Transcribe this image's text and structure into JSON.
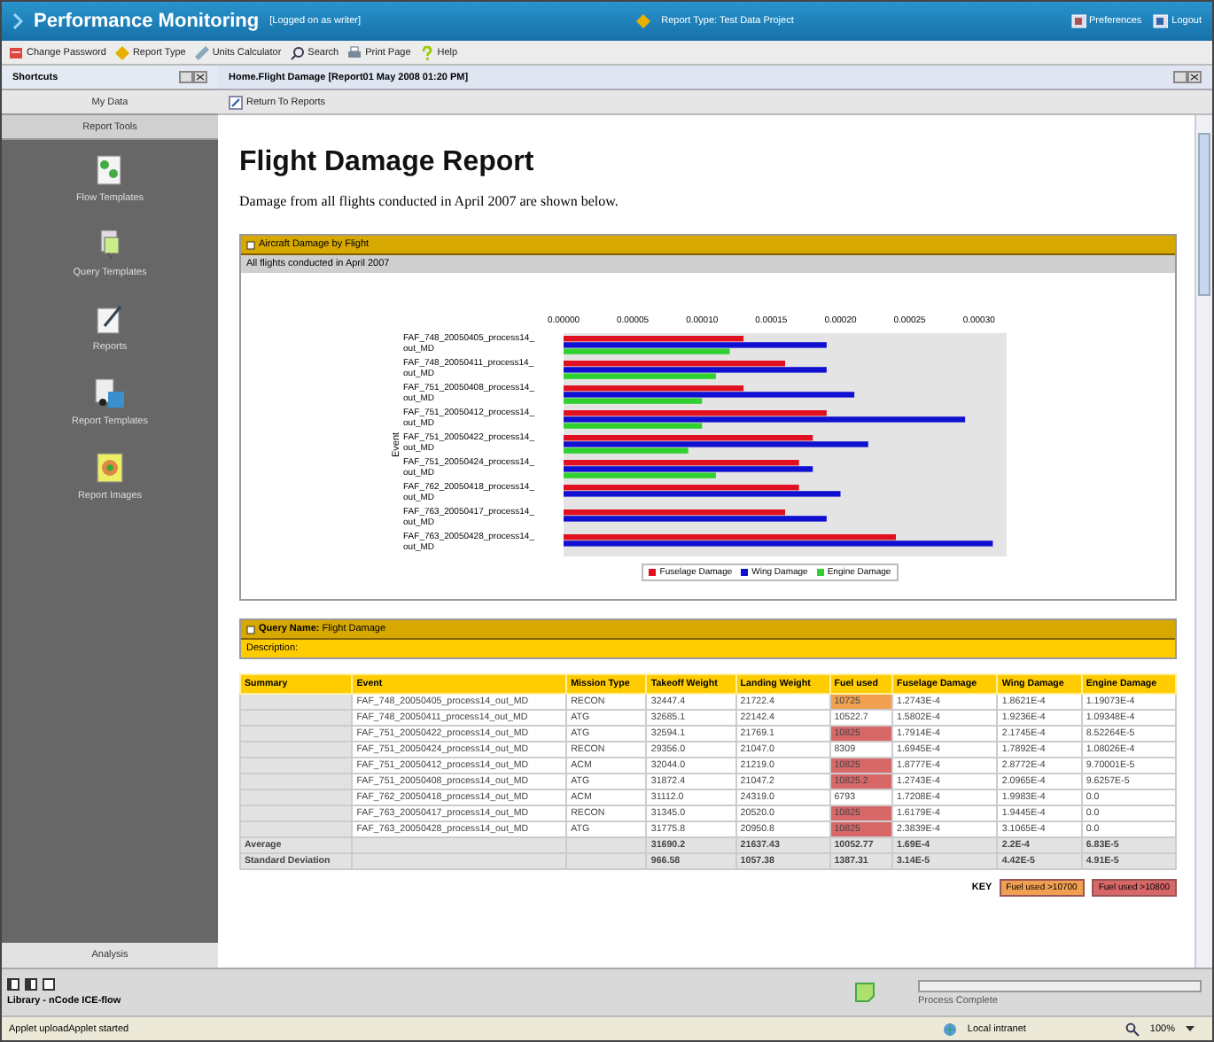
{
  "header": {
    "title": "Performance Monitoring",
    "login_note": "[Logged on as writer]",
    "report_type": "Report Type: Test Data Project",
    "actions": [
      "Preferences",
      "Logout"
    ]
  },
  "toolbar": [
    "Change Password",
    "Report Type",
    "Units Calculator",
    "Search",
    "Print Page",
    "Help"
  ],
  "sidebar": {
    "title": "Shortcuts",
    "sections": [
      {
        "label": "My Data",
        "selected": false
      },
      {
        "label": "Report Tools",
        "selected": true
      }
    ],
    "items": [
      "Flow Templates",
      "Query Templates",
      "Reports",
      "Report Templates",
      "Report Images"
    ],
    "footer": "Analysis"
  },
  "panel": {
    "title": "Home.Flight Damage [Report01 May 2008 01:20 PM]",
    "action": "Return To Reports"
  },
  "report": {
    "title": "Flight Damage Report",
    "intro": "Damage from all flights conducted in April 2007 are shown below.",
    "chart_panel": {
      "title": "Aircraft Damage by Flight",
      "subtitle": "All flights conducted in April 2007",
      "chart_data": {
        "type": "bar",
        "orientation": "horizontal",
        "ylabel": "Event",
        "categories": [
          "FAF_748_20050405_process14_out_MD",
          "FAF_748_20050411_process14_out_MD",
          "FAF_751_20050408_process14_out_MD",
          "FAF_751_20050412_process14_out_MD",
          "FAF_751_20050422_process14_out_MD",
          "FAF_751_20050424_process14_out_MD",
          "FAF_762_20050418_process14_out_MD",
          "FAF_763_20050417_process14_out_MD",
          "FAF_763_20050428_process14_out_MD"
        ],
        "series": [
          {
            "name": "Fuselage Damage",
            "color": "#e01020",
            "values": [
              0.00013,
              0.00016,
              0.00013,
              0.00019,
              0.00018,
              0.00017,
              0.00017,
              0.00016,
              0.00024
            ]
          },
          {
            "name": "Wing Damage",
            "color": "#1010d0",
            "values": [
              0.00019,
              0.00019,
              0.00021,
              0.00029,
              0.00022,
              0.00018,
              0.0002,
              0.00019,
              0.00031
            ]
          },
          {
            "name": "Engine Damage",
            "color": "#30d030",
            "values": [
              0.00012,
              0.00011,
              0.0001,
              0.0001,
              9e-05,
              0.00011,
              0,
              0,
              0
            ]
          }
        ],
        "legend": true,
        "xlim": [
          0,
          0.00032
        ],
        "xticks": [
          {
            "value": 0,
            "label": "0.00000"
          },
          {
            "value": 5e-05,
            "label": "0.00005"
          },
          {
            "value": 0.0001,
            "label": "0.00010"
          },
          {
            "value": 0.00015,
            "label": "0.00015"
          },
          {
            "value": 0.0002,
            "label": "0.00020"
          },
          {
            "value": 0.00025,
            "label": "0.00025"
          },
          {
            "value": 0.0003,
            "label": "0.00030"
          }
        ]
      }
    },
    "query": {
      "name": "**Query Name:** Flight Damage",
      "description": "Description:"
    },
    "table": {
      "columns": [
        "Summary",
        "Event",
        "Mission Type",
        "Takeoff Weight",
        "Landing Weight",
        "Fuel used",
        "Fuselage Damage",
        "Wing Damage",
        "Engine Damage"
      ],
      "rows": [
        {
          "event": "FAF_748_20050405_process14_out_MD",
          "mission": "RECON",
          "takeoff": "32447.4",
          "landing": "21722.4",
          "fuel": "10725",
          "color": "#f0a050",
          "fuselage": "1.2743E-4",
          "wing": "1.8621E-4",
          "engine": "1.19073E-4"
        },
        {
          "event": "FAF_748_20050411_process14_out_MD",
          "mission": "ATG",
          "takeoff": "32685.1",
          "landing": "22142.4",
          "fuel": "10522.7",
          "fuselage": "1.5802E-4",
          "wing": "1.9236E-4",
          "engine": "1.09348E-4"
        },
        {
          "event": "FAF_751_20050422_process14_out_MD",
          "mission": "ATG",
          "takeoff": "32594.1",
          "landing": "21769.1",
          "fuel": "10825",
          "color": "#d86868",
          "fuselage": "1.7914E-4",
          "wing": "2.1745E-4",
          "engine": "8.52264E-5"
        },
        {
          "event": "FAF_751_20050424_process14_out_MD",
          "mission": "RECON",
          "takeoff": "29356.0",
          "landing": "21047.0",
          "fuel": "8309",
          "fuselage": "1.6945E-4",
          "wing": "1.7892E-4",
          "engine": "1.08026E-4"
        },
        {
          "event": "FAF_751_20050412_process14_out_MD",
          "mission": "ACM",
          "takeoff": "32044.0",
          "landing": "21219.0",
          "fuel": "10825",
          "color": "#d86868",
          "fuselage": "1.8777E-4",
          "wing": "2.8772E-4",
          "engine": "9.70001E-5"
        },
        {
          "event": "FAF_751_20050408_process14_out_MD",
          "mission": "ATG",
          "takeoff": "31872.4",
          "landing": "21047.2",
          "fuel": "10825.2",
          "color": "#d86868",
          "fuselage": "1.2743E-4",
          "wing": "2.0965E-4",
          "engine": "9.6257E-5"
        },
        {
          "event": "FAF_762_20050418_process14_out_MD",
          "mission": "ACM",
          "takeoff": "31112.0",
          "landing": "24319.0",
          "fuel": "6793",
          "fuselage": "1.7208E-4",
          "wing": "1.9983E-4",
          "engine": "0.0"
        },
        {
          "event": "FAF_763_20050417_process14_out_MD",
          "mission": "RECON",
          "takeoff": "31345.0",
          "landing": "20520.0",
          "fuel": "10825",
          "color": "#d86868",
          "fuselage": "1.6179E-4",
          "wing": "1.9445E-4",
          "engine": "0.0"
        },
        {
          "event": "FAF_763_20050428_process14_out_MD",
          "mission": "ATG",
          "takeoff": "31775.8",
          "landing": "20950.8",
          "fuel": "10825",
          "color": "#d86868",
          "fuselage": "2.3839E-4",
          "wing": "3.1065E-4",
          "engine": "0.0"
        }
      ],
      "summary_rows": [
        {
          "label": "Average",
          "takeoff": "31690.2",
          "landing": "21637.43",
          "fuel": "10052.77",
          "fuselage": "1.69E-4",
          "wing": "2.2E-4",
          "engine": "6.83E-5"
        },
        {
          "label": "Standard Deviation",
          "takeoff": "966.58",
          "landing": "1057.38",
          "fuel": "1387.31",
          "fuselage": "3.14E-5",
          "wing": "4.42E-5",
          "engine": "4.91E-5"
        }
      ]
    },
    "key": {
      "label": "KEY",
      "items": [
        {
          "label": "Fuel used >10700",
          "color": "#f0a050"
        },
        {
          "label": "Fuel used >10800",
          "color": "#d86868"
        }
      ]
    }
  },
  "bottom": {
    "library": "Library - nCode ICE-flow",
    "process": "Process Complete",
    "level": 0
  },
  "status_bar": {
    "message": "Applet uploadApplet started",
    "zone": "Local intranet",
    "zoom": "100%"
  }
}
